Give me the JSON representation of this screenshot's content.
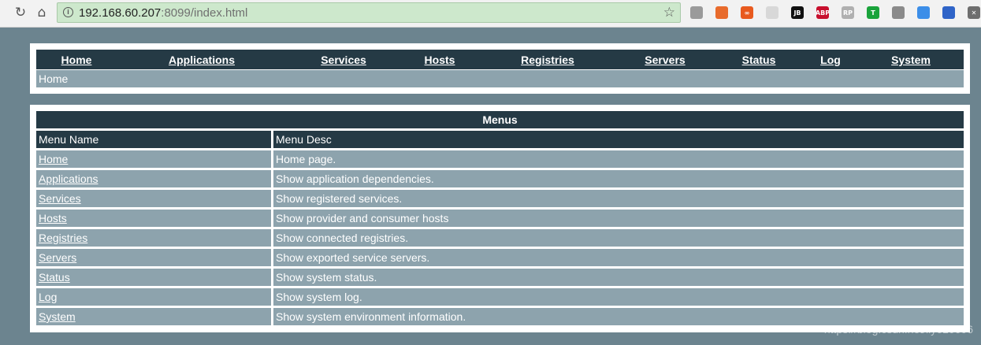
{
  "browser": {
    "url_host": "192.168.60.207",
    "url_rest": ":8099/index.html"
  },
  "extensions": [
    {
      "name": "circle-extension-icon",
      "label": "",
      "color": "#9a9a9a"
    },
    {
      "name": "orange-extension-icon",
      "label": "",
      "color": "#e86b2c"
    },
    {
      "name": "infinity-extension-icon",
      "label": "∞",
      "color": "#e85a1e"
    },
    {
      "name": "page-extension-icon",
      "label": "",
      "color": "#d8d8d8"
    },
    {
      "name": "jb-extension-icon",
      "label": "JB",
      "color": "#111111"
    },
    {
      "name": "abp-extension-icon",
      "label": "ABP",
      "color": "#c8102e"
    },
    {
      "name": "rp-extension-icon",
      "label": "RP",
      "color": "#b0b0b0"
    },
    {
      "name": "shield-extension-icon",
      "label": "T",
      "color": "#1aa33b"
    },
    {
      "name": "grey-extension-icon",
      "label": "",
      "color": "#8a8a8a"
    },
    {
      "name": "chrome-extension-icon",
      "label": "",
      "color": "#3c8ee8"
    },
    {
      "name": "blue-extension-icon",
      "label": "",
      "color": "#2f64c8"
    },
    {
      "name": "x-extension-icon",
      "label": "✕",
      "color": "#6e6e6e"
    }
  ],
  "nav": {
    "items": [
      {
        "label": "Home"
      },
      {
        "label": "Applications"
      },
      {
        "label": "Services"
      },
      {
        "label": "Hosts"
      },
      {
        "label": "Registries"
      },
      {
        "label": "Servers"
      },
      {
        "label": "Status"
      },
      {
        "label": "Log"
      },
      {
        "label": "System"
      }
    ],
    "breadcrumb": "Home"
  },
  "menus": {
    "title": "Menus",
    "headers": [
      "Menu Name",
      "Menu Desc"
    ],
    "rows": [
      {
        "name": "Home",
        "desc": "Home page."
      },
      {
        "name": "Applications",
        "desc": "Show application dependencies."
      },
      {
        "name": "Services",
        "desc": "Show registered services."
      },
      {
        "name": "Hosts",
        "desc": "Show provider and consumer hosts"
      },
      {
        "name": "Registries",
        "desc": "Show connected registries."
      },
      {
        "name": "Servers",
        "desc": "Show exported service servers."
      },
      {
        "name": "Status",
        "desc": "Show system status."
      },
      {
        "name": "Log",
        "desc": "Show system log."
      },
      {
        "name": "System",
        "desc": "Show system environment information."
      }
    ]
  },
  "watermark": "https://blog.csdn.net/lly610606"
}
